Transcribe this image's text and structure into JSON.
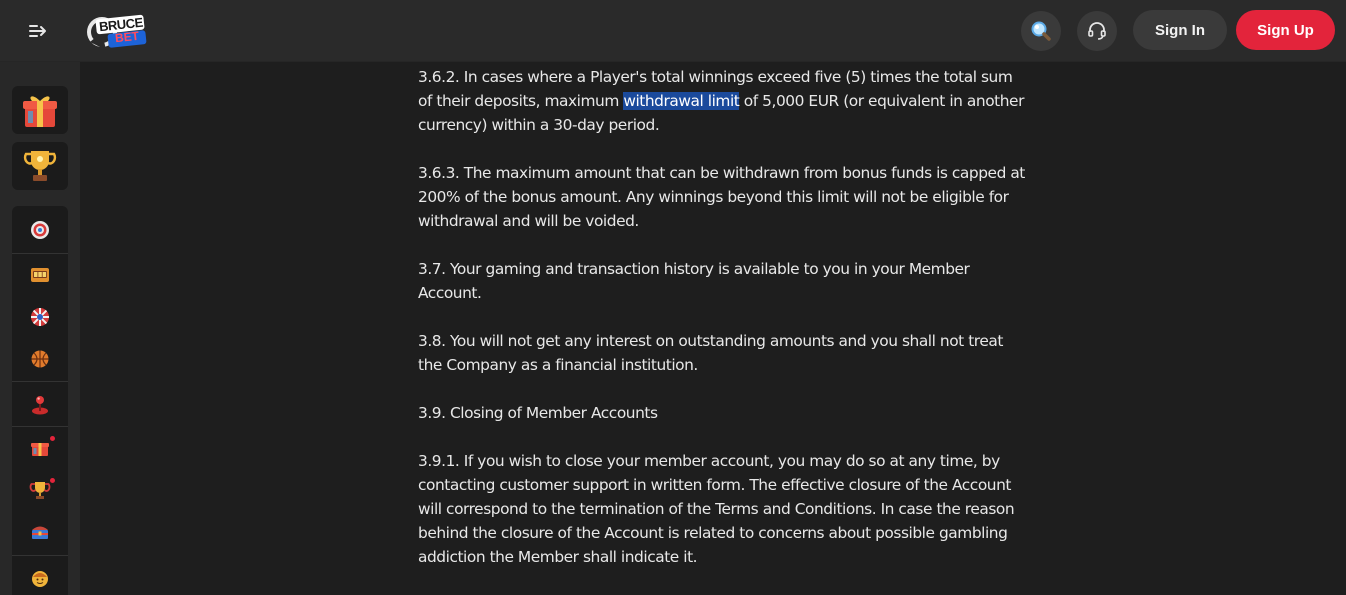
{
  "header": {
    "logo_text_top": "BRUCE",
    "logo_text_bottom": "BET",
    "signin_label": "Sign In",
    "signup_label": "Sign Up",
    "accent_color": "#e3243b"
  },
  "sidebar": {
    "promos": [
      {
        "icon": "gift-box-icon"
      },
      {
        "icon": "trophy-icon"
      }
    ],
    "items": [
      {
        "icon": "target-icon"
      },
      {
        "icon": "slot-machine-icon"
      },
      {
        "icon": "roulette-wheel-icon"
      },
      {
        "icon": "basketball-icon"
      },
      {
        "icon": "joystick-icon"
      },
      {
        "icon": "gift-icon",
        "badge": true
      },
      {
        "icon": "winner-cup-icon",
        "badge": true
      },
      {
        "icon": "treasure-chest-icon"
      },
      {
        "icon": "face-icon"
      }
    ]
  },
  "content": {
    "p1_before": "3.6.2. In cases where a Player's total winnings exceed five (5) times the total sum of their deposits, maximum ",
    "p1_highlight": "withdrawal limit",
    "p1_after": " of 5,000 EUR (or equivalent in another currency) within a 30-day period.",
    "p2": "3.6.3. The maximum amount that can be withdrawn from bonus funds is capped at 200% of the bonus amount. Any winnings beyond this limit will not be eligible for withdrawal and will be voided.",
    "p3": "3.7. Your gaming and transaction history is available to you in your Member Account.",
    "p4": "3.8. You will not get any interest on outstanding amounts and you shall not treat the Company as a financial institution.",
    "p5": "3.9. Closing of Member Accounts",
    "p6": "3.9.1. If you wish to close your member account, you may do so at any time, by contacting customer support in written form. The effective closure of the Account will correspond to the termination of the Terms and Conditions. In case the reason behind the closure of the Account is related to concerns about possible gambling addiction the Member shall indicate it."
  }
}
